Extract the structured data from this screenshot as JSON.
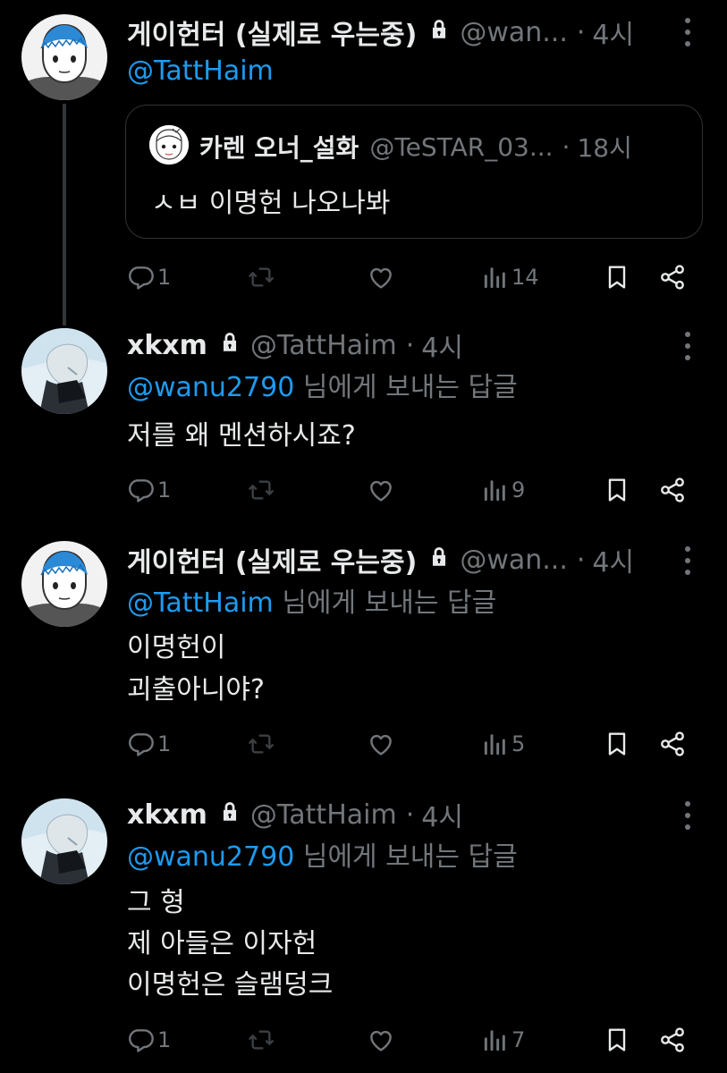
{
  "tweets": [
    {
      "name": "게이헌터 (실제로 우는중)",
      "handle": "@wan...",
      "time": "4시",
      "mention": "@TattHaim",
      "quote": {
        "name": "카렌 오너_설화",
        "handle": "@TeSTAR_03...",
        "time": "18시",
        "text": "ㅅㅂ 이명헌 나오나봐"
      },
      "replies": "1",
      "views": "14"
    },
    {
      "name": "xkxm",
      "handle": "@TattHaim",
      "time": "4시",
      "mention": "@wanu2790",
      "reply_suffix": "님에게 보내는 답글",
      "lines": [
        "저를 왜 멘션하시죠?"
      ],
      "replies": "1",
      "views": "9"
    },
    {
      "name": "게이헌터 (실제로 우는중)",
      "handle": "@wan...",
      "time": "4시",
      "mention": "@TattHaim",
      "reply_suffix": "님에게 보내는 답글",
      "lines": [
        "이명헌이",
        "괴출아니야?"
      ],
      "replies": "1",
      "views": "5"
    },
    {
      "name": "xkxm",
      "handle": "@TattHaim",
      "time": "4시",
      "mention": "@wanu2790",
      "reply_suffix": "님에게 보내는 답글",
      "lines": [
        "그 형",
        "제 아들은 이자헌",
        "이명헌은 슬램덩크"
      ],
      "replies": "1",
      "views": "7"
    }
  ],
  "colors": {
    "accent": "#1d9bf0",
    "muted": "#71767b",
    "text": "#e7e9ea",
    "background": "#000000"
  },
  "icons": [
    "lock-icon",
    "more-icon",
    "reply-icon",
    "retweet-icon",
    "like-icon",
    "views-icon",
    "bookmark-icon",
    "share-icon"
  ]
}
